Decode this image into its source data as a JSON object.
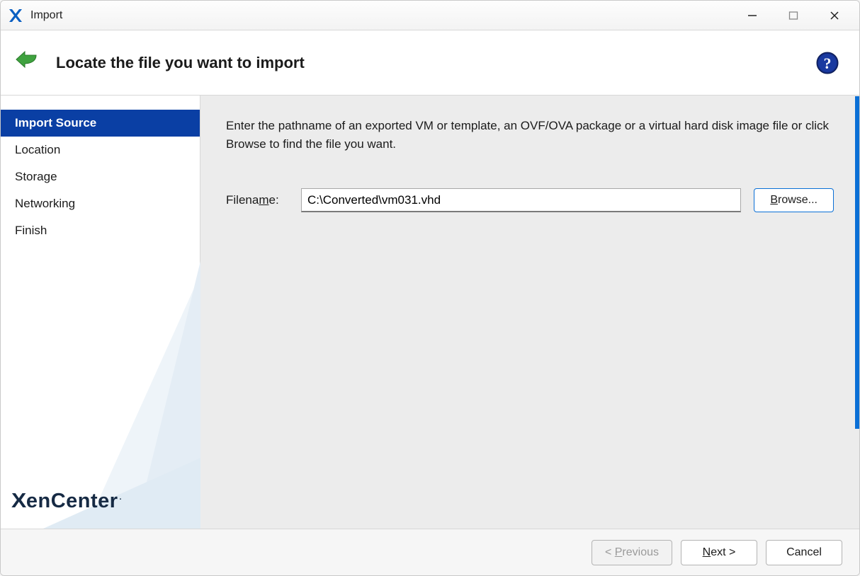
{
  "window": {
    "title": "Import"
  },
  "header": {
    "heading": "Locate the file you want to import"
  },
  "sidebar": {
    "steps": [
      {
        "label": "Import Source",
        "active": true
      },
      {
        "label": "Location",
        "active": false
      },
      {
        "label": "Storage",
        "active": false
      },
      {
        "label": "Networking",
        "active": false
      },
      {
        "label": "Finish",
        "active": false
      }
    ],
    "brand": "XenCenter"
  },
  "main": {
    "instructions": "Enter the pathname of an exported VM or template, an OVF/OVA package or a virtual hard disk image file or click Browse to find the file you want.",
    "filename_label_pre": "Filena",
    "filename_label_ul": "m",
    "filename_label_post": "e:",
    "filename_value": "C:\\Converted\\vm031.vhd",
    "browse_ul": "B",
    "browse_post": "rowse..."
  },
  "footer": {
    "prev_pre": "< ",
    "prev_ul": "P",
    "prev_post": "revious",
    "next_ul": "N",
    "next_post": "ext >",
    "cancel": "Cancel"
  }
}
